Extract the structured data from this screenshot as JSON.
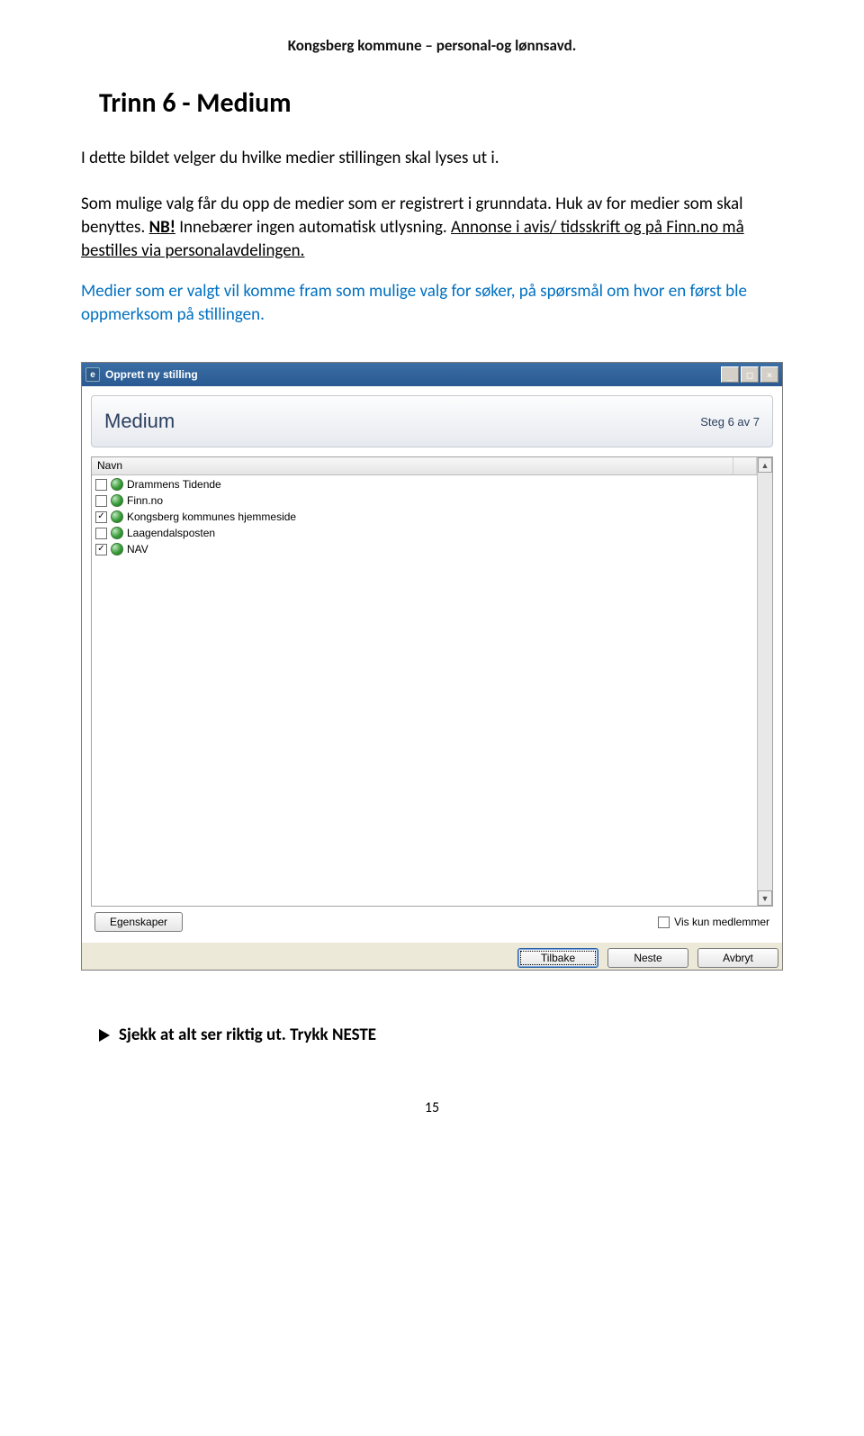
{
  "doc_header": "Kongsberg kommune – personal-og lønnsavd.",
  "heading": "Trinn 6 - Medium",
  "para1_a": "I dette bildet velger du hvilke medier stillingen skal lyses ut i.",
  "para1_b": "Som mulige valg får du opp de medier som er registrert i grunndata. Huk av for medier som skal benyttes. ",
  "nb": "NB!",
  "para1_c": " Innebærer ingen automatisk utlysning. ",
  "para1_underline": "Annonse i avis/ tidsskrift og på Finn.no må bestilles via personalavdelingen.",
  "para_blue": "Medier som er valgt vil komme fram som mulige valg for søker, på spørsmål om hvor en først ble oppmerksom på stillingen.",
  "window": {
    "title": "Opprett ny stilling",
    "banner_title": "Medium",
    "step": "Steg 6 av 7",
    "col_navn": "Navn",
    "rows": [
      {
        "label": "Drammens Tidende",
        "checked": false
      },
      {
        "label": "Finn.no",
        "checked": false
      },
      {
        "label": "Kongsberg kommunes hjemmeside",
        "checked": true
      },
      {
        "label": "Laagendalsposten",
        "checked": false
      },
      {
        "label": "NAV",
        "checked": true
      }
    ],
    "egenskaper": "Egenskaper",
    "vis_kun": "Vis kun medlemmer",
    "btn_tilbake": "Tilbake",
    "btn_neste": "Neste",
    "btn_avbryt": "Avbryt",
    "win_min": "_",
    "win_max": "□",
    "win_close": "×"
  },
  "bullet": "Sjekk at alt ser riktig ut. Trykk NESTE",
  "page_num": "15"
}
